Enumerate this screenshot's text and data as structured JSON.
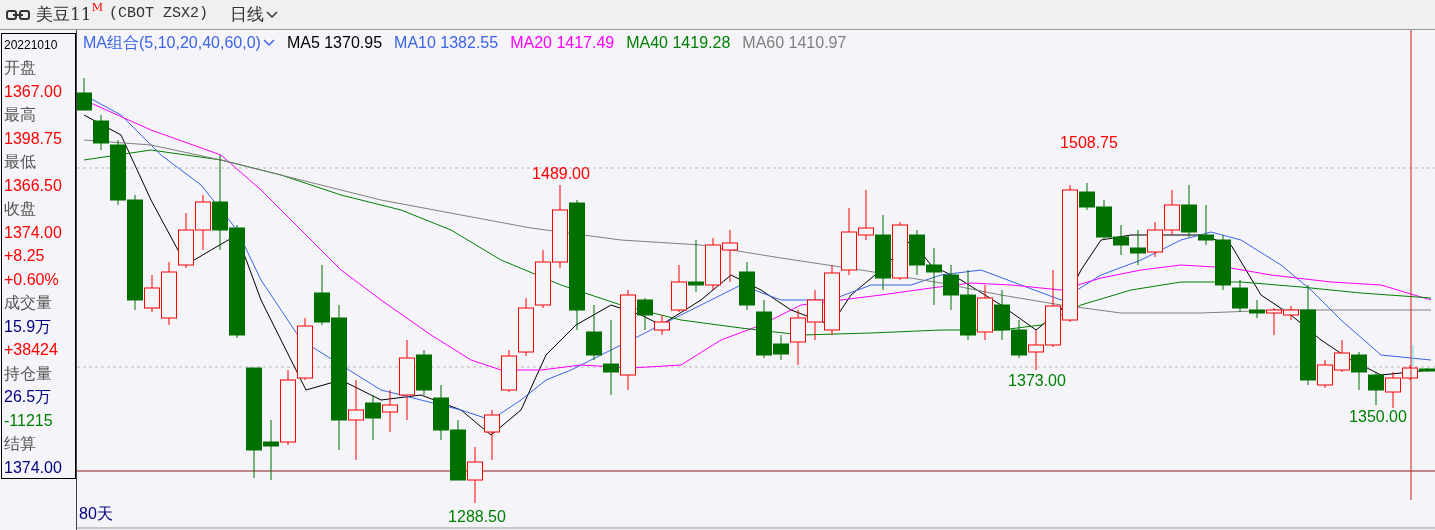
{
  "toolbar": {
    "symbol": "美豆11",
    "superscript": "M",
    "code": "(CBOT ZSX2)",
    "period": "日线"
  },
  "info_panel": {
    "date": "20221010",
    "rows": [
      {
        "kind": "label",
        "text": "开盘"
      },
      {
        "kind": "value",
        "text": "1367.00",
        "color": "#ff0000"
      },
      {
        "kind": "label",
        "text": "最高"
      },
      {
        "kind": "value",
        "text": "1398.75",
        "color": "#ff0000"
      },
      {
        "kind": "label",
        "text": "最低"
      },
      {
        "kind": "value",
        "text": "1366.50",
        "color": "#ff0000"
      },
      {
        "kind": "label",
        "text": "收盘"
      },
      {
        "kind": "value",
        "text": "1374.00",
        "color": "#ff0000"
      },
      {
        "kind": "value",
        "text": "+8.25",
        "color": "#ff0000"
      },
      {
        "kind": "value",
        "text": "+0.60%",
        "color": "#ff0000"
      },
      {
        "kind": "label",
        "text": "成交量"
      },
      {
        "kind": "value",
        "text": "15.9万",
        "color": "#000080"
      },
      {
        "kind": "value",
        "text": "+38424",
        "color": "#ff0000"
      },
      {
        "kind": "label",
        "text": "持仓量"
      },
      {
        "kind": "value",
        "text": "26.5万",
        "color": "#000080"
      },
      {
        "kind": "value",
        "text": "-11215",
        "color": "#008000"
      },
      {
        "kind": "label",
        "text": "结算"
      },
      {
        "kind": "value",
        "text": "1374.00",
        "color": "#000080"
      }
    ]
  },
  "ma_legend": {
    "selector": "MA组合(5,10,20,40,60,0)",
    "items": [
      {
        "name": "MA5",
        "value": "1370.95",
        "color": "#000000"
      },
      {
        "name": "MA10",
        "value": "1382.55",
        "color": "#3c64e6"
      },
      {
        "name": "MA20",
        "value": "1417.49",
        "color": "#ff00ff"
      },
      {
        "name": "MA40",
        "value": "1419.28",
        "color": "#008000"
      },
      {
        "name": "MA60",
        "value": "1410.97",
        "color": "#808080"
      }
    ]
  },
  "chart": {
    "annotations": [
      {
        "text": "1489.00",
        "color": "#ff0000"
      },
      {
        "text": "1508.75",
        "color": "#ff0000"
      },
      {
        "text": "1373.00",
        "color": "#008000"
      },
      {
        "text": "1350.00",
        "color": "#008000"
      },
      {
        "text": "1288.50",
        "color": "#008000"
      }
    ],
    "period_label": "80天"
  }
}
